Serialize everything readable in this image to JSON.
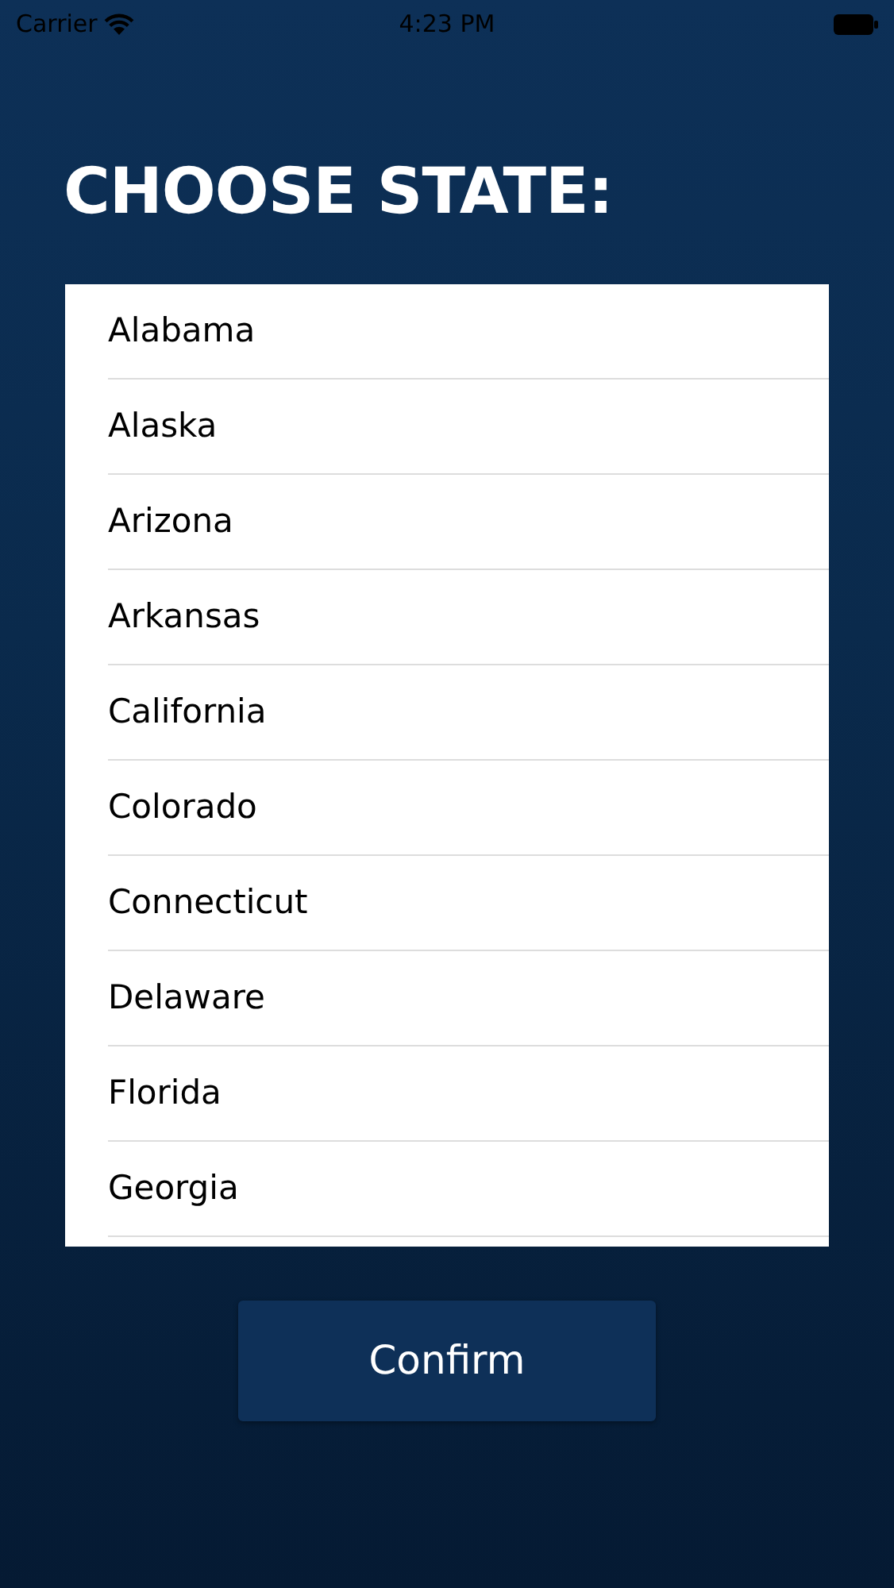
{
  "status_bar": {
    "carrier": "Carrier",
    "time": "4:23 PM"
  },
  "title": "CHOOSE STATE:",
  "states": [
    "Alabama",
    "Alaska",
    "Arizona",
    "Arkansas",
    "California",
    "Colorado",
    "Connecticut",
    "Delaware",
    "Florida",
    "Georgia"
  ],
  "confirm_button": "Confirm"
}
